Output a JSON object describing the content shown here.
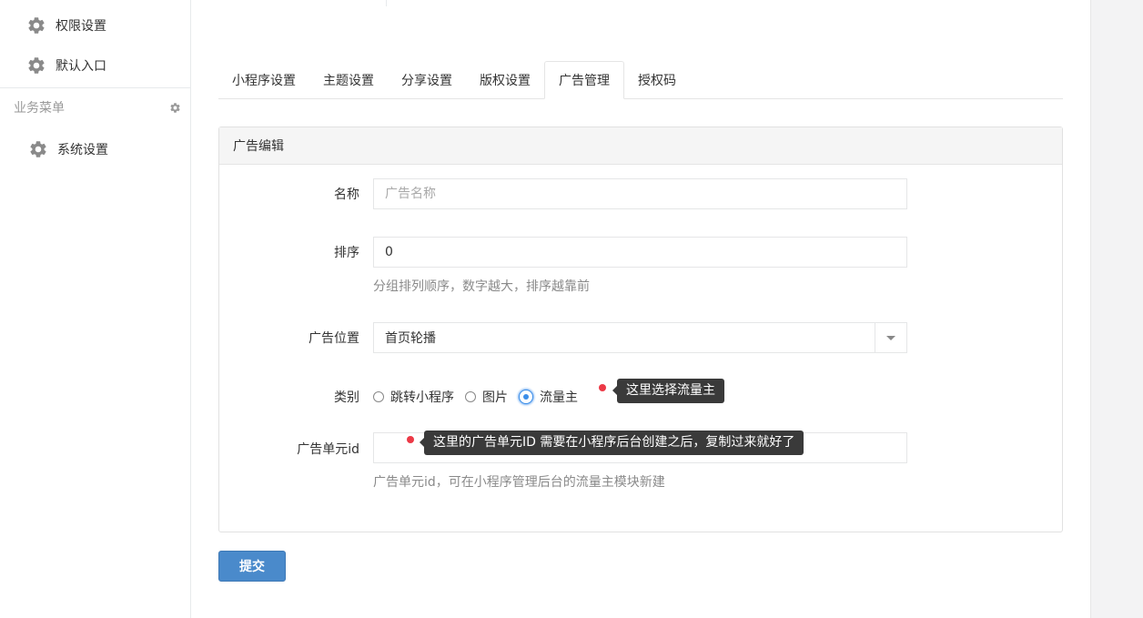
{
  "sidebar": {
    "items_top": [
      {
        "label": "权限设置",
        "icon": "gear-icon"
      },
      {
        "label": "默认入口",
        "icon": "gear-icon"
      }
    ],
    "group_label": "业务菜单",
    "group_items": [
      {
        "label": "系统设置",
        "icon": "gear-icon"
      }
    ]
  },
  "tabs": [
    {
      "label": "小程序设置"
    },
    {
      "label": "主题设置"
    },
    {
      "label": "分享设置"
    },
    {
      "label": "版权设置"
    },
    {
      "label": "广告管理",
      "active": true
    },
    {
      "label": "授权码"
    }
  ],
  "panel": {
    "title": "广告编辑",
    "name": {
      "label": "名称",
      "value": "",
      "placeholder": "广告名称"
    },
    "sort": {
      "label": "排序",
      "value": "0",
      "help": "分组排列顺序，数字越大，排序越靠前"
    },
    "position": {
      "label": "广告位置",
      "selected": "首页轮播"
    },
    "type": {
      "label": "类别",
      "options": [
        {
          "label": "跳转小程序",
          "checked": false
        },
        {
          "label": "图片",
          "checked": false
        },
        {
          "label": "流量主",
          "checked": true
        }
      ]
    },
    "unit_id": {
      "label": "广告单元id",
      "value": "",
      "help": "广告单元id，可在小程序管理后台的流量主模块新建"
    }
  },
  "annotations": {
    "type_tip": "这里选择流量主",
    "unit_tip": "这里的广告单元ID 需要在小程序后台创建之后，复制过来就好了"
  },
  "submit_label": "提交",
  "colors": {
    "primary": "#4a8acb",
    "pin": "#ec3946",
    "tooltip": "#3a3a3a",
    "radio_checked": "#3b8ee9"
  }
}
